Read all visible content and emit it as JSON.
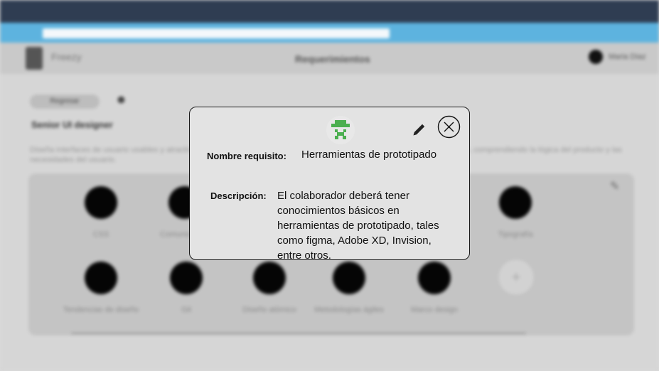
{
  "background": {
    "app_name": "Freezy",
    "header_title": "Requerimientos",
    "user_name": "Maria Diaz",
    "back_button_label": "Regresar",
    "role_title": "Senior UI designer",
    "role_description": "Diseña interfaces de usuario usables y atractivas, aplicando principios de diseño y las metodologías establecidas por el equipo, comprendiendo la lógica del producto y las necesidades del usuario.",
    "skills": [
      {
        "label": "CSS"
      },
      {
        "label": "Comunicación"
      },
      {
        "label": "Tipografía"
      },
      {
        "label": "Tendencias de diseño"
      },
      {
        "label": "Git"
      },
      {
        "label": "Diseño atómico"
      },
      {
        "label": "Metodologías ágiles"
      },
      {
        "label": "Marco design"
      }
    ],
    "add_skill_symbol": "+"
  },
  "modal": {
    "avatar_icon": "pixel-avatar-icon",
    "edit_icon": "pencil-icon",
    "close_icon": "close-circle-icon",
    "name_label": "Nombre requisito:",
    "name_value": "Herramientas de prototipado",
    "description_label": "Descripción:",
    "description_value": "El colaborador deberá tener conocimientos básicos en herramientas de prototipado, tales como figma, Adobe XD, Invision, entre otros.",
    "accent_color": "#4caf50"
  }
}
